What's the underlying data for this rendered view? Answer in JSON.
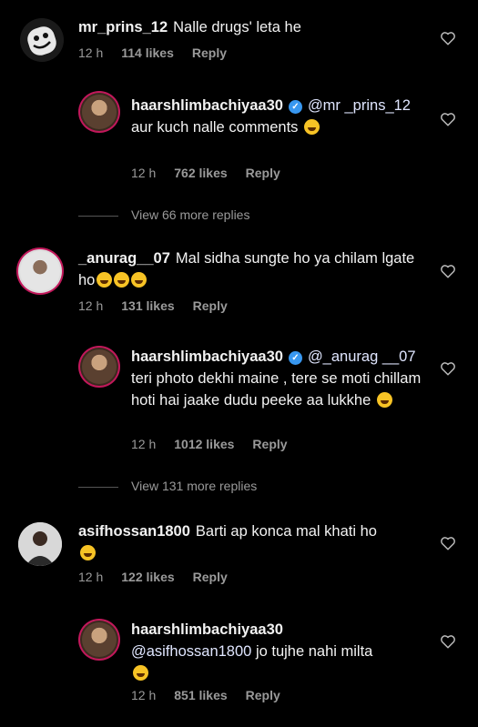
{
  "comments": [
    {
      "username": "mr_prins_12",
      "text": "Nalle drugs' leta he",
      "time": "12 h",
      "likes": "114 likes",
      "reply": "Reply",
      "avatar_icon": "marshmello-mask-icon"
    },
    {
      "username": "haarshlimbachiyaa30",
      "verified": true,
      "mention": "@mr _prins_12",
      "text": "aur kuch nalle comments",
      "time": "12 h",
      "likes": "762 likes",
      "reply": "Reply"
    },
    {
      "view_more": "View 66 more replies"
    },
    {
      "username": "_anurag__07",
      "text": "Mal sidha sungte ho ya chilam lgate ho",
      "time": "12 h",
      "likes": "131 likes",
      "reply": "Reply"
    },
    {
      "username": "haarshlimbachiyaa30",
      "verified": true,
      "mention": "@_anurag __07",
      "text": "teri photo dekhi maine , tere se moti chillam hoti hai jaake dudu peeke aa lukkhe",
      "time": "12 h",
      "likes": "1012 likes",
      "reply": "Reply"
    },
    {
      "view_more": "View 131 more replies"
    },
    {
      "username": "asifhossan1800",
      "text": "Barti ap konca mal khati ho",
      "time": "12 h",
      "likes": "122 likes",
      "reply": "Reply"
    },
    {
      "username": "haarshlimbachiyaa30",
      "mention": "@asifhossan1800",
      "text": "jo tujhe nahi milta",
      "time": "12 h",
      "likes": "851 likes",
      "reply": "Reply"
    }
  ],
  "colors": {
    "background": "#000000",
    "meta_text": "#9a9a9a",
    "verified_badge": "#3897f0",
    "story_ring": "#c2185b"
  }
}
